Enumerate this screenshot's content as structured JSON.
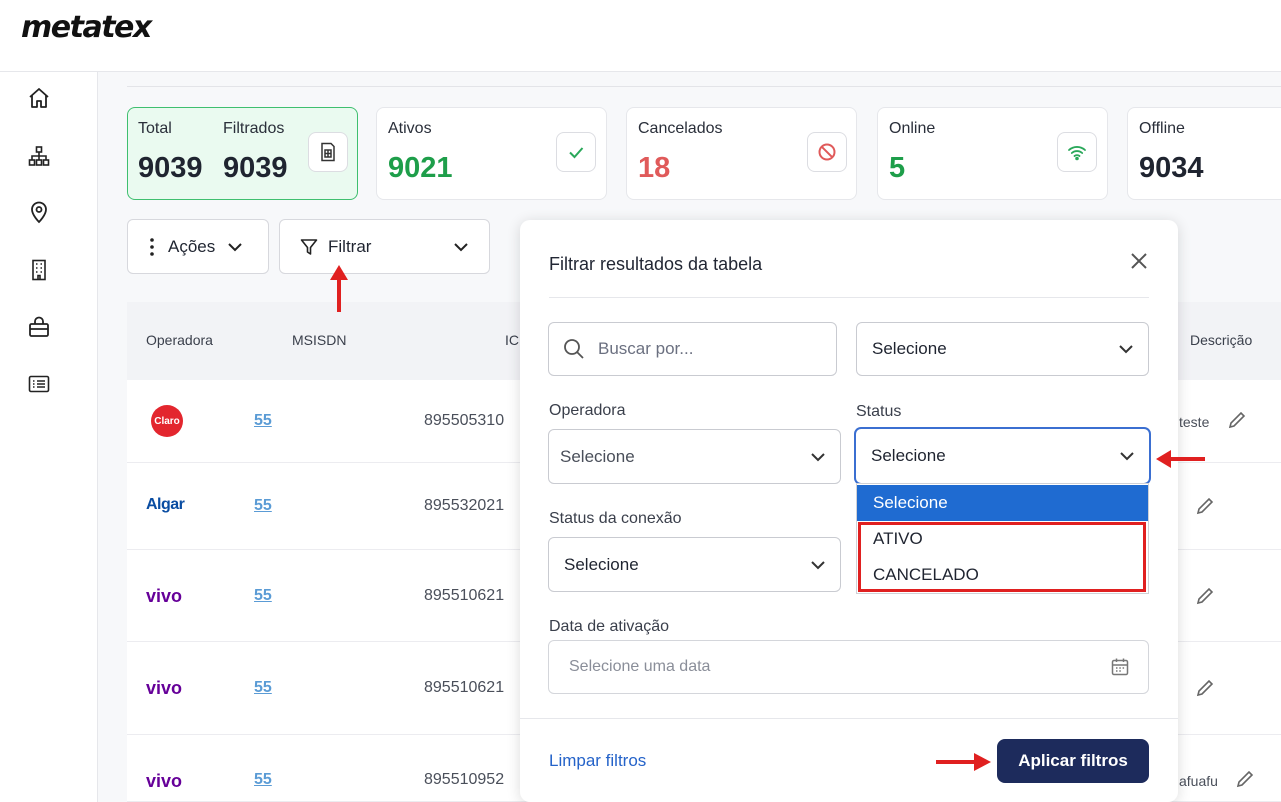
{
  "brand": {
    "logo": "metatex"
  },
  "sidebar": {
    "items": [
      {
        "name": "home",
        "icon": "home-icon"
      },
      {
        "name": "hierarchy",
        "icon": "sitemap-icon"
      },
      {
        "name": "location",
        "icon": "map-pin-icon"
      },
      {
        "name": "buildings",
        "icon": "building-icon"
      },
      {
        "name": "shop",
        "icon": "shopping-bag-icon"
      },
      {
        "name": "list",
        "icon": "list-icon"
      }
    ]
  },
  "stats": {
    "total_label": "Total",
    "total_value": "9039",
    "filtrados_label": "Filtrados",
    "filtrados_value": "9039",
    "ativos_label": "Ativos",
    "ativos_value": "9021",
    "cancelados_label": "Cancelados",
    "cancelados_value": "18",
    "online_label": "Online",
    "online_value": "5",
    "offline_label": "Offline",
    "offline_value": "9034",
    "colors": {
      "green": "#1e9e4a",
      "red": "#e05a5a",
      "dark": "#1f2430"
    }
  },
  "toolbar": {
    "acoes_label": "Ações",
    "filtrar_label": "Filtrar"
  },
  "table": {
    "headers": {
      "operadora": "Operadora",
      "msisdn": "MSISDN",
      "iccid": "IC",
      "descricao": "Descrição"
    },
    "rows": [
      {
        "operator": "Claro",
        "msisdn": "55",
        "iccid": "895505310",
        "desc": "teste"
      },
      {
        "operator": "Algar",
        "msisdn": "55",
        "iccid": "895532021",
        "desc": ""
      },
      {
        "operator": "vivo",
        "msisdn": "55",
        "iccid": "895510621",
        "desc": ""
      },
      {
        "operator": "vivo",
        "msisdn": "55",
        "iccid": "895510621",
        "desc": ""
      },
      {
        "operator": "vivo",
        "msisdn": "55",
        "iccid": "895510952",
        "desc": "afuafu"
      }
    ]
  },
  "filter_panel": {
    "title": "Filtrar resultados da tabela",
    "search_placeholder": "Buscar por...",
    "top_select": "Selecione",
    "operadora_label": "Operadora",
    "operadora_value": "Selecione",
    "status_label": "Status",
    "status_value": "Selecione",
    "status_options": [
      "Selecione",
      "ATIVO",
      "CANCELADO"
    ],
    "conexao_label": "Status da conexão",
    "conexao_value": "Selecione",
    "data_label": "Data de ativação",
    "data_placeholder": "Selecione uma data",
    "clear_label": "Limpar filtros",
    "apply_label": "Aplicar filtros"
  },
  "annotation_color": "#e02020"
}
